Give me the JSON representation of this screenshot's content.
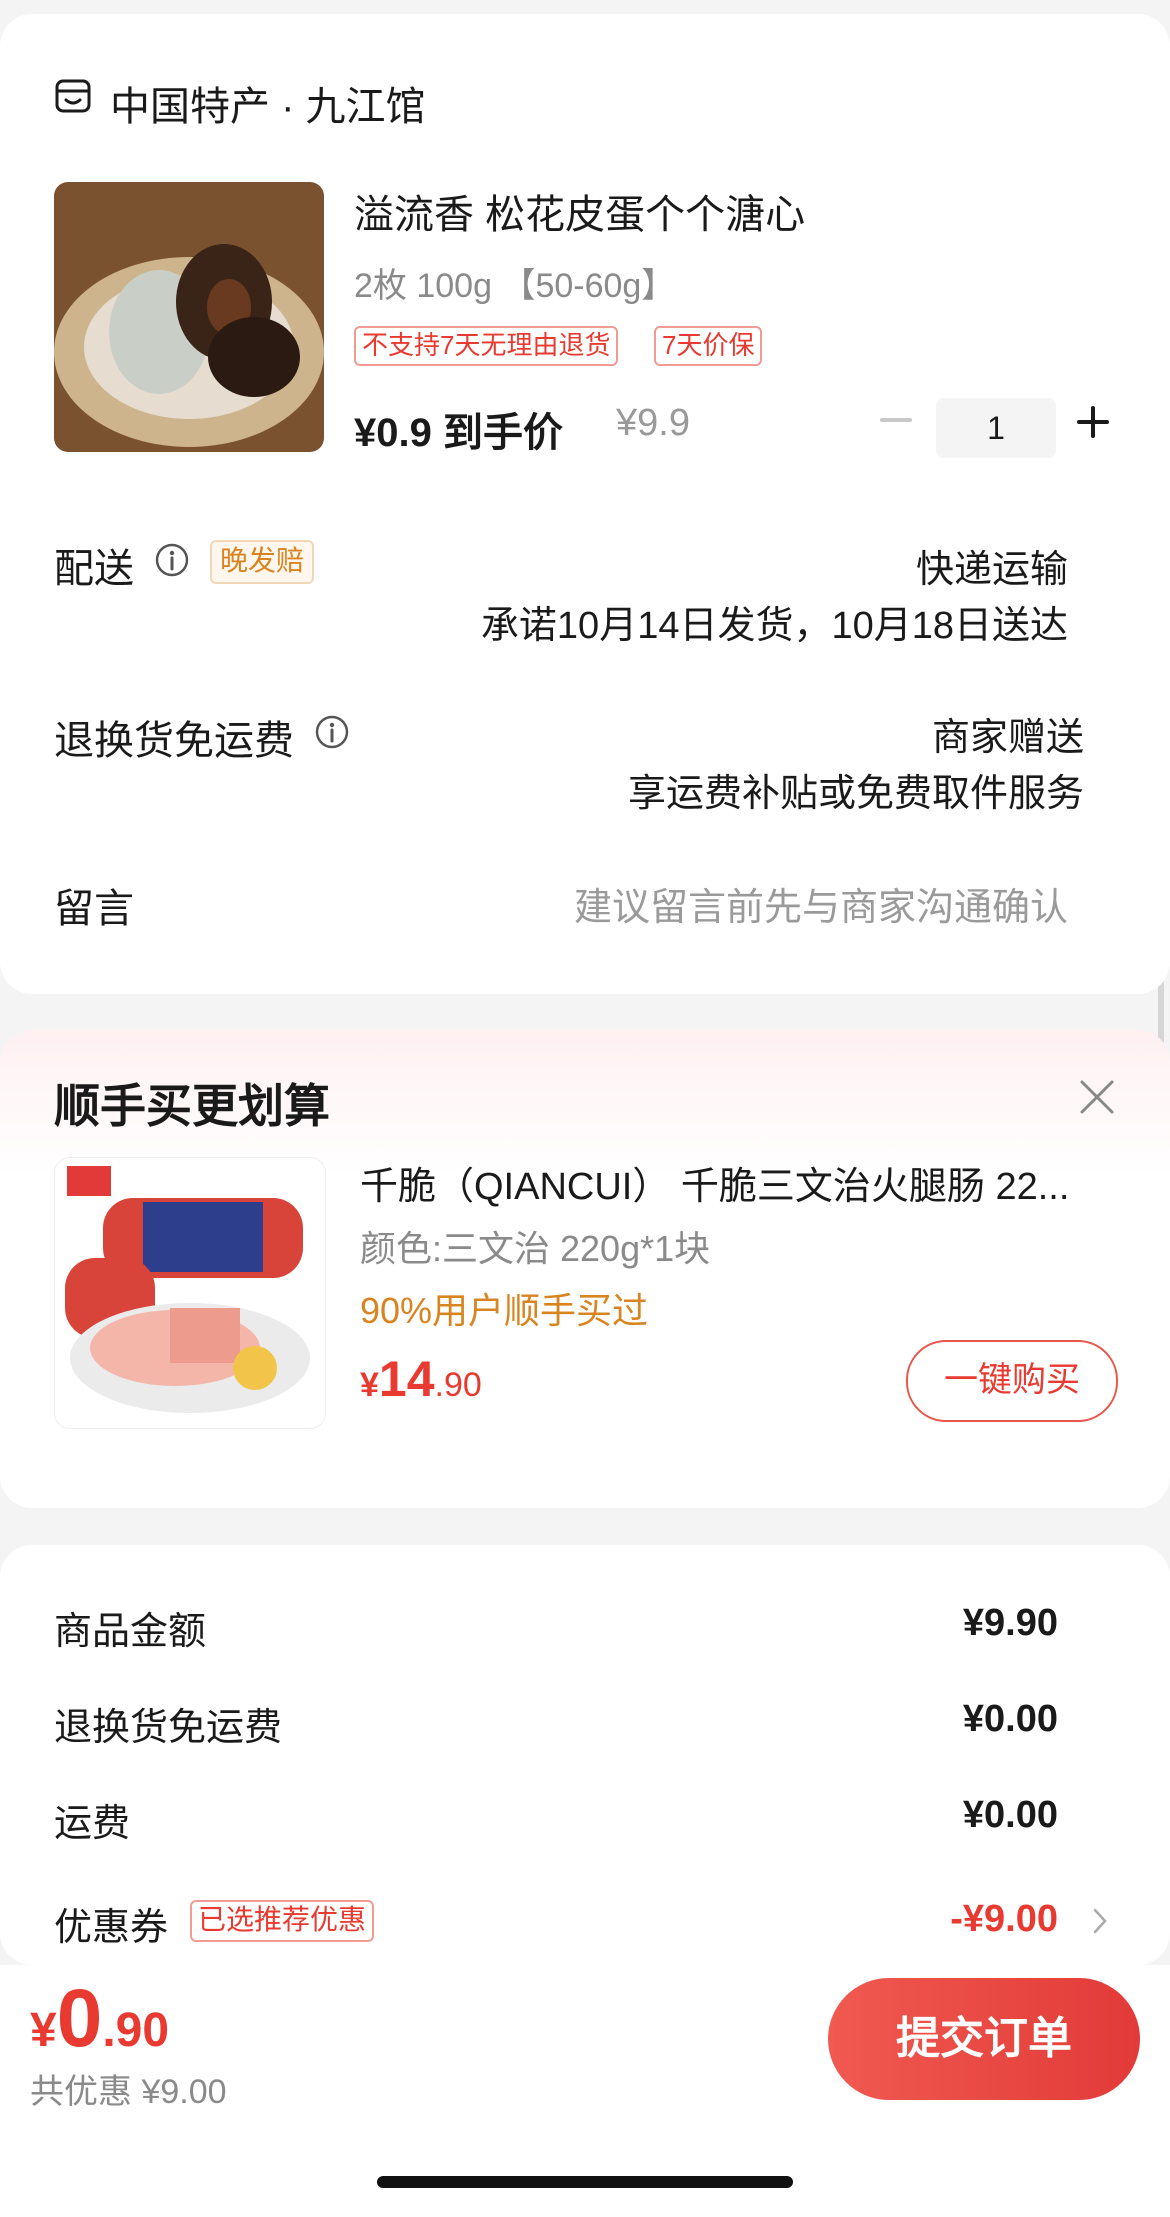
{
  "shop": {
    "icon": "shop-icon",
    "name": "中国特产 · 九江馆"
  },
  "product": {
    "title": "溢流香 松花皮蛋个个溏心",
    "spec": "2枚 100g 【50-60g】",
    "tags": [
      "不支持7天无理由退货",
      "7天价保"
    ],
    "price": "¥0.9 到手价",
    "original_price": "¥9.9",
    "quantity": "1"
  },
  "delivery": {
    "label": "配送",
    "badge": "晚发赔",
    "method": "快递运输",
    "promise": "承诺10月14日发货，10月18日送达"
  },
  "return_shipping": {
    "label": "退换货免运费",
    "value": "商家赠送",
    "detail": "享运费补贴或免费取件服务"
  },
  "message": {
    "label": "留言",
    "placeholder": "建议留言前先与商家沟通确认"
  },
  "addon": {
    "title": "顺手买更划算",
    "name": "千脆（QIANCUI） 千脆三文治火腿肠 22...",
    "spec": "颜色:三文治 220g*1块",
    "popularity": "90%用户顺手买过",
    "price_symbol": "¥",
    "price_int": "14",
    "price_dec": ".90",
    "buy_label": "一键购买"
  },
  "summary": [
    {
      "label": "商品金额",
      "value": "¥9.90"
    },
    {
      "label": "退换货免运费",
      "value": "¥0.00"
    },
    {
      "label": "运费",
      "value": "¥0.00"
    }
  ],
  "coupon": {
    "label": "优惠券",
    "tag": "已选推荐优惠",
    "value": "-¥9.00"
  },
  "footer": {
    "total_symbol": "¥",
    "total_int": "0",
    "total_dec": ".90",
    "saving": "共优惠 ¥9.00",
    "submit_label": "提交订单"
  },
  "colors": {
    "accent": "#e83a30",
    "orange": "#d88420",
    "muted": "#8a8a8a"
  }
}
